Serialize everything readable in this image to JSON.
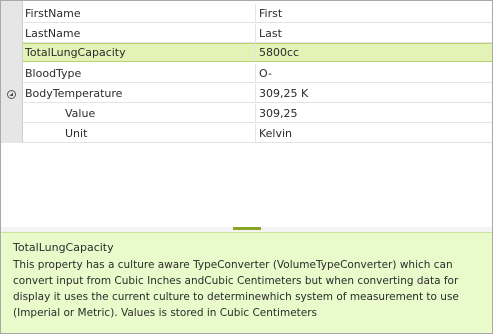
{
  "properties": [
    {
      "name": "FirstName",
      "value": "First"
    },
    {
      "name": "LastName",
      "value": "Last"
    },
    {
      "name": "TotalLungCapacity",
      "value": "5800cc",
      "selected": true
    },
    {
      "name": "BloodType",
      "value": "O-"
    },
    {
      "name": "BodyTemperature",
      "value": "309,25 K",
      "expander_icon": "collapse-circle-icon"
    },
    {
      "name": "Value",
      "value": "309,25",
      "child": true
    },
    {
      "name": "Unit",
      "value": "Kelvin",
      "child": true
    }
  ],
  "description": {
    "title": "TotalLungCapacity",
    "text": "This property has a culture aware TypeConverter (VolumeTypeConverter) which can convert input from Cubic Inches andCubic Centimeters but when converting data for display it uses the current culture to determinewhich system of measurement to use (Imperial or Metric). Values is stored in Cubic Centimeters"
  },
  "colors": {
    "selection": "#e3f2b6",
    "description_background": "#e9fbcb",
    "splitter_grip": "#8aa524",
    "gutter": "#e6e6e6"
  }
}
